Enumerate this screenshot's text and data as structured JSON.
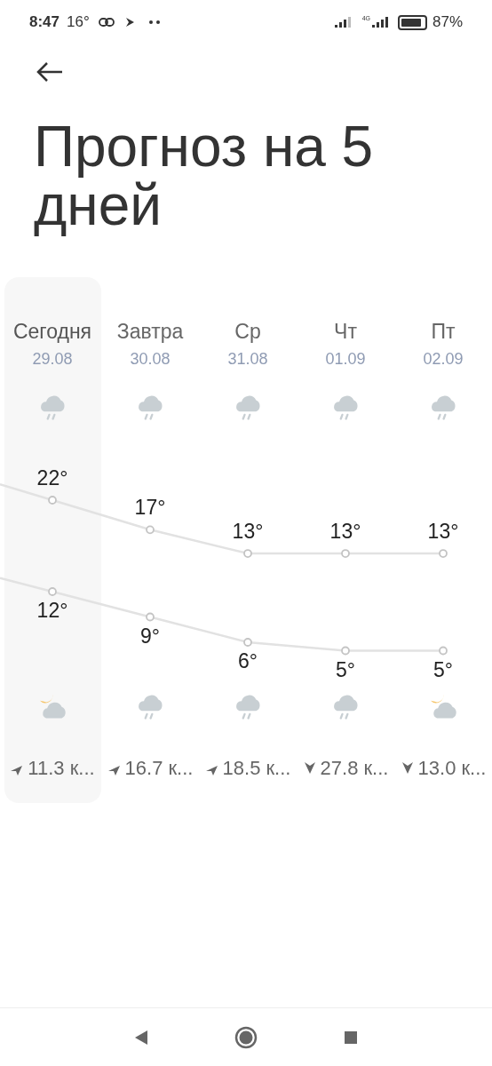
{
  "status_bar": {
    "time": "8:47",
    "temperature": "16°",
    "network": "4G",
    "battery": "87%"
  },
  "title": "Прогноз на 5 дней",
  "days": [
    {
      "name": "Сегодня",
      "date": "29.08",
      "selected": true,
      "day_weather": {
        "kind": "rain"
      },
      "high": "22°",
      "low": "12°",
      "night_weather": {
        "kind": "partly_cloudy"
      },
      "wind": {
        "kind": "northeast",
        "text": "11.3 к..."
      }
    },
    {
      "name": "Завтра",
      "date": "30.08",
      "selected": false,
      "day_weather": {
        "kind": "rain"
      },
      "high": "17°",
      "low": "9°",
      "night_weather": {
        "kind": "rain"
      },
      "wind": {
        "kind": "northeast",
        "text": "16.7 к..."
      }
    },
    {
      "name": "Ср",
      "date": "31.08",
      "selected": false,
      "day_weather": {
        "kind": "rain"
      },
      "high": "13°",
      "low": "6°",
      "night_weather": {
        "kind": "rain"
      },
      "wind": {
        "kind": "northeast",
        "text": "18.5 к..."
      }
    },
    {
      "name": "Чт",
      "date": "01.09",
      "selected": false,
      "day_weather": {
        "kind": "rain"
      },
      "high": "13°",
      "low": "5°",
      "night_weather": {
        "kind": "rain"
      },
      "wind": {
        "kind": "south",
        "text": "27.8 к..."
      }
    },
    {
      "name": "Пт",
      "date": "02.09",
      "selected": false,
      "day_weather": {
        "kind": "rain"
      },
      "high": "13°",
      "low": "5°",
      "night_weather": {
        "kind": "partly_cloudy"
      },
      "wind": {
        "kind": "south",
        "text": "13.0 к..."
      }
    }
  ]
}
